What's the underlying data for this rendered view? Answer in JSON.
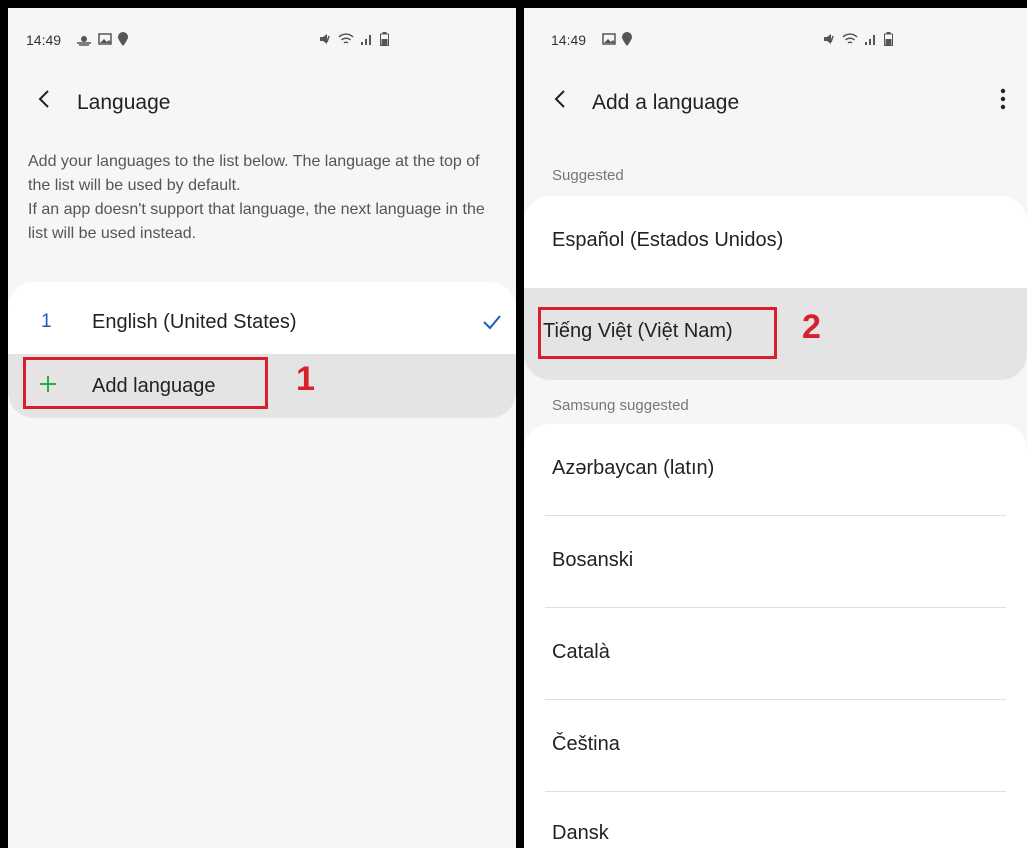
{
  "left_screen": {
    "status": {
      "time": "14:49",
      "icons_left": [
        "weather-icon",
        "gallery-icon",
        "location-icon"
      ],
      "icons_right": [
        "mute-icon",
        "wifi-icon",
        "signal-icon",
        "battery-icon"
      ]
    },
    "title": "Language",
    "description": "Add your languages to the list below. The language at the top of the list will be used by default.\nIf an app doesn't support that language, the next language in the list will be used instead.",
    "languages": [
      {
        "index": "1",
        "name": "English (United States)",
        "selected": true
      }
    ],
    "add_label": "Add language",
    "step_label": "1"
  },
  "right_screen": {
    "status": {
      "time": "14:49",
      "icons_left": [
        "gallery-icon",
        "location-icon"
      ],
      "icons_right": [
        "mute-icon",
        "wifi-icon",
        "signal-icon",
        "battery-icon"
      ]
    },
    "title": "Add a language",
    "suggested_header": "Suggested",
    "suggested": [
      "Español (Estados Unidos)",
      "Tiếng Việt (Việt Nam)"
    ],
    "samsung_header": "Samsung suggested",
    "samsung_suggested": [
      "Azərbaycan (latın)",
      "Bosanski",
      "Català",
      "Čeština",
      "Dansk"
    ],
    "step_label": "2"
  },
  "colors": {
    "accent": "#1f5bc4",
    "plus": "#2fa84f",
    "highlight": "#d8202a",
    "background": "#f6f6f6"
  }
}
